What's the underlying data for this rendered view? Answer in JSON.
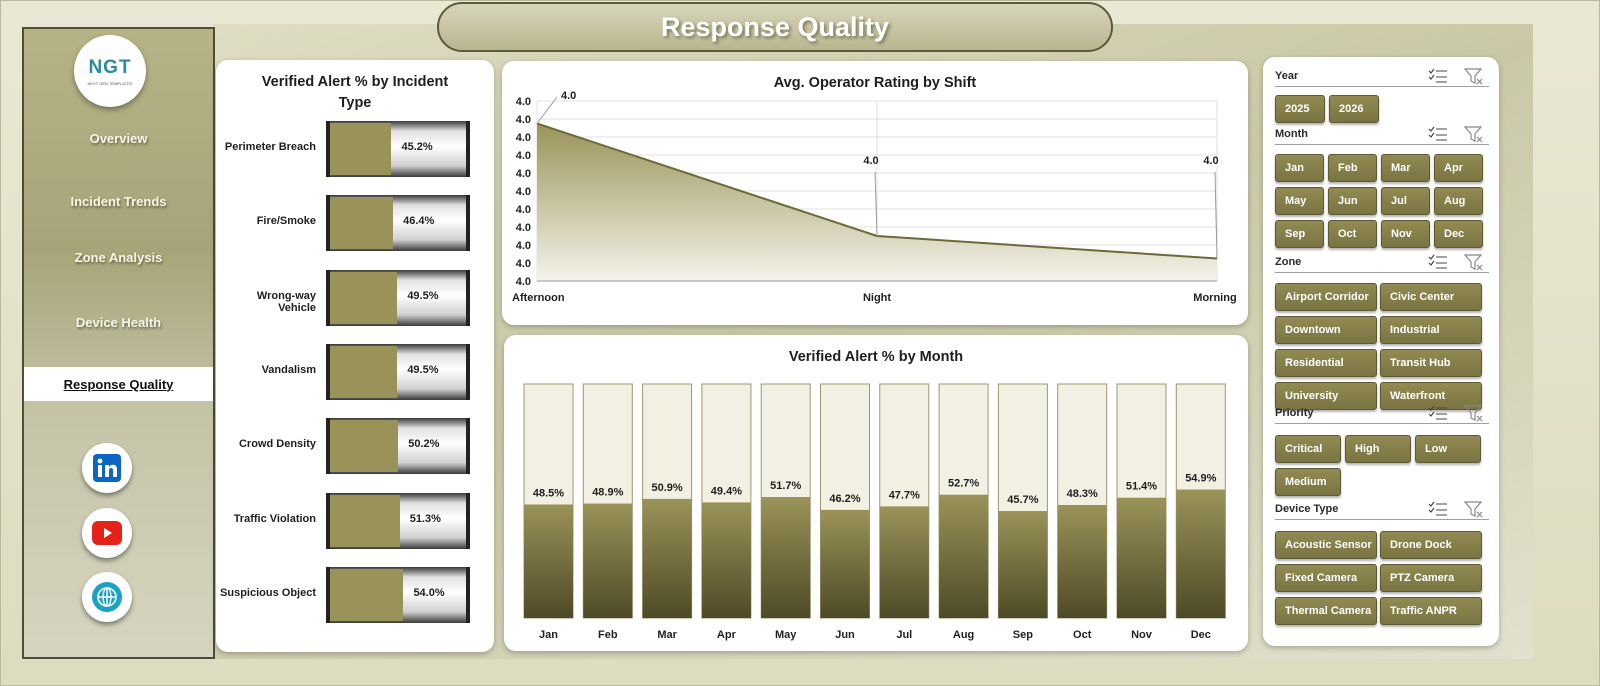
{
  "title": "Response Quality",
  "sidebar": {
    "logo_text": "NGT",
    "logo_sub": "NEXT GEN TEMPLATES",
    "items": [
      {
        "label": "Overview"
      },
      {
        "label": "Incident Trends"
      },
      {
        "label": "Zone Analysis"
      },
      {
        "label": "Device Health"
      },
      {
        "label": "Response Quality"
      }
    ],
    "social": [
      "linkedin-icon",
      "youtube-icon",
      "website-globe-icon"
    ]
  },
  "left_chart": {
    "title_line1": "Verified Alert % by Incident",
    "title_line2": "Type",
    "rows": [
      {
        "label": "Perimeter Breach",
        "value": 45.2,
        "text": "45.2%"
      },
      {
        "label": "Fire/Smoke",
        "value": 46.4,
        "text": "46.4%"
      },
      {
        "label": "Wrong-way Vehicle",
        "value": 49.5,
        "text": "49.5%"
      },
      {
        "label": "Vandalism",
        "value": 49.5,
        "text": "49.5%"
      },
      {
        "label": "Crowd Density",
        "value": 50.2,
        "text": "50.2%"
      },
      {
        "label": "Traffic Violation",
        "value": 51.3,
        "text": "51.3%"
      },
      {
        "label": "Suspicious Object",
        "value": 54.0,
        "text": "54.0%"
      }
    ]
  },
  "chart_data": [
    {
      "type": "area",
      "title": "Avg. Operator Rating by Shift",
      "categories": [
        "Afternoon",
        "Night",
        "Morning"
      ],
      "values": [
        4.04,
        3.99,
        3.98
      ],
      "data_labels": [
        "4.0",
        "4.0",
        "4.0"
      ],
      "ytick_labels": [
        "4.0",
        "4.0",
        "4.0",
        "4.0",
        "4.0",
        "4.0",
        "4.0",
        "4.0",
        "4.0",
        "4.0",
        "4.0"
      ],
      "ylim": [
        3.97,
        4.05
      ],
      "grid": true
    },
    {
      "type": "bar",
      "title": "Verified Alert % by Month",
      "categories": [
        "Jan",
        "Feb",
        "Mar",
        "Apr",
        "May",
        "Jun",
        "Jul",
        "Aug",
        "Sep",
        "Oct",
        "Nov",
        "Dec"
      ],
      "values": [
        48.5,
        48.9,
        50.9,
        49.4,
        51.7,
        46.2,
        47.7,
        52.7,
        45.7,
        48.3,
        51.4,
        54.9
      ],
      "labels": [
        "48.5%",
        "48.9%",
        "50.9%",
        "49.4%",
        "51.7%",
        "46.2%",
        "47.7%",
        "52.7%",
        "45.7%",
        "48.3%",
        "51.4%",
        "54.9%"
      ],
      "ylim": [
        0,
        100
      ]
    }
  ],
  "slicers": {
    "year": {
      "title": "Year",
      "items": [
        "2025",
        "2026"
      ]
    },
    "month": {
      "title": "Month",
      "items": [
        "Jan",
        "Feb",
        "Mar",
        "Apr",
        "May",
        "Jun",
        "Jul",
        "Aug",
        "Sep",
        "Oct",
        "Nov",
        "Dec"
      ]
    },
    "zone": {
      "title": "Zone",
      "items": [
        "Airport Corridor",
        "Civic Center",
        "Downtown",
        "Industrial",
        "Residential",
        "Transit Hub",
        "University",
        "Waterfront"
      ]
    },
    "priority": {
      "title": "Priority",
      "items": [
        "Critical",
        "High",
        "Low",
        "Medium"
      ]
    },
    "device": {
      "title": "Device Type",
      "items": [
        "Acoustic Sensor",
        "Drone Dock",
        "Fixed Camera",
        "PTZ Camera",
        "Thermal Camera",
        "Traffic ANPR"
      ]
    }
  },
  "colors": {
    "accent": "#8c8550",
    "bar_fill": "#9a9359",
    "area_line": "#6e6939"
  }
}
